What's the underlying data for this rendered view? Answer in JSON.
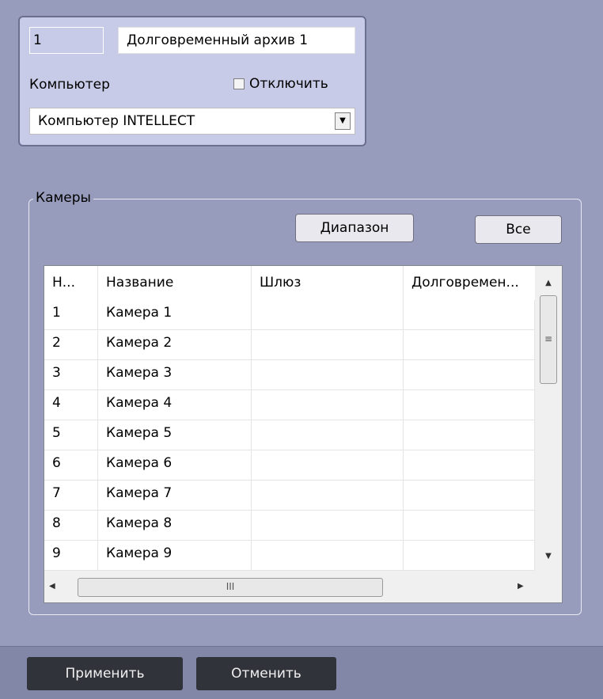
{
  "archive": {
    "id": "1",
    "name": "Долговременный архив 1",
    "computer_label": "Компьютер",
    "disable_label": "Отключить",
    "disable_checked": false,
    "computer_value": "Компьютер INTELLECT",
    "dropdown_arrow": "▼"
  },
  "cameras": {
    "group_label": "Камеры",
    "range_button": "Диапазон",
    "all_button": "Все",
    "columns": [
      "Н...",
      "Название",
      "Шлюз",
      "Долговремен..."
    ],
    "rows": [
      {
        "num": "1",
        "name": "Камера 1",
        "gateway": "",
        "archive": ""
      },
      {
        "num": "2",
        "name": "Камера 2",
        "gateway": "",
        "archive": ""
      },
      {
        "num": "3",
        "name": "Камера 3",
        "gateway": "",
        "archive": ""
      },
      {
        "num": "4",
        "name": "Камера 4",
        "gateway": "",
        "archive": ""
      },
      {
        "num": "5",
        "name": "Камера 5",
        "gateway": "",
        "archive": ""
      },
      {
        "num": "6",
        "name": "Камера 6",
        "gateway": "",
        "archive": ""
      },
      {
        "num": "7",
        "name": "Камера 7",
        "gateway": "",
        "archive": ""
      },
      {
        "num": "8",
        "name": "Камера 8",
        "gateway": "",
        "archive": ""
      },
      {
        "num": "9",
        "name": "Камера 9",
        "gateway": "",
        "archive": ""
      }
    ],
    "scroll": {
      "up": "▲",
      "down": "▼",
      "left": "◀",
      "right": "▶",
      "v_grip": "≡",
      "h_grip": "III"
    }
  },
  "footer": {
    "apply_button": "Применить",
    "cancel_button": "Отменить"
  },
  "colors": {
    "background": "#979cbc",
    "panel": "#c8cbe7",
    "footer": "#8287a8",
    "footer_button": "#31333b"
  }
}
